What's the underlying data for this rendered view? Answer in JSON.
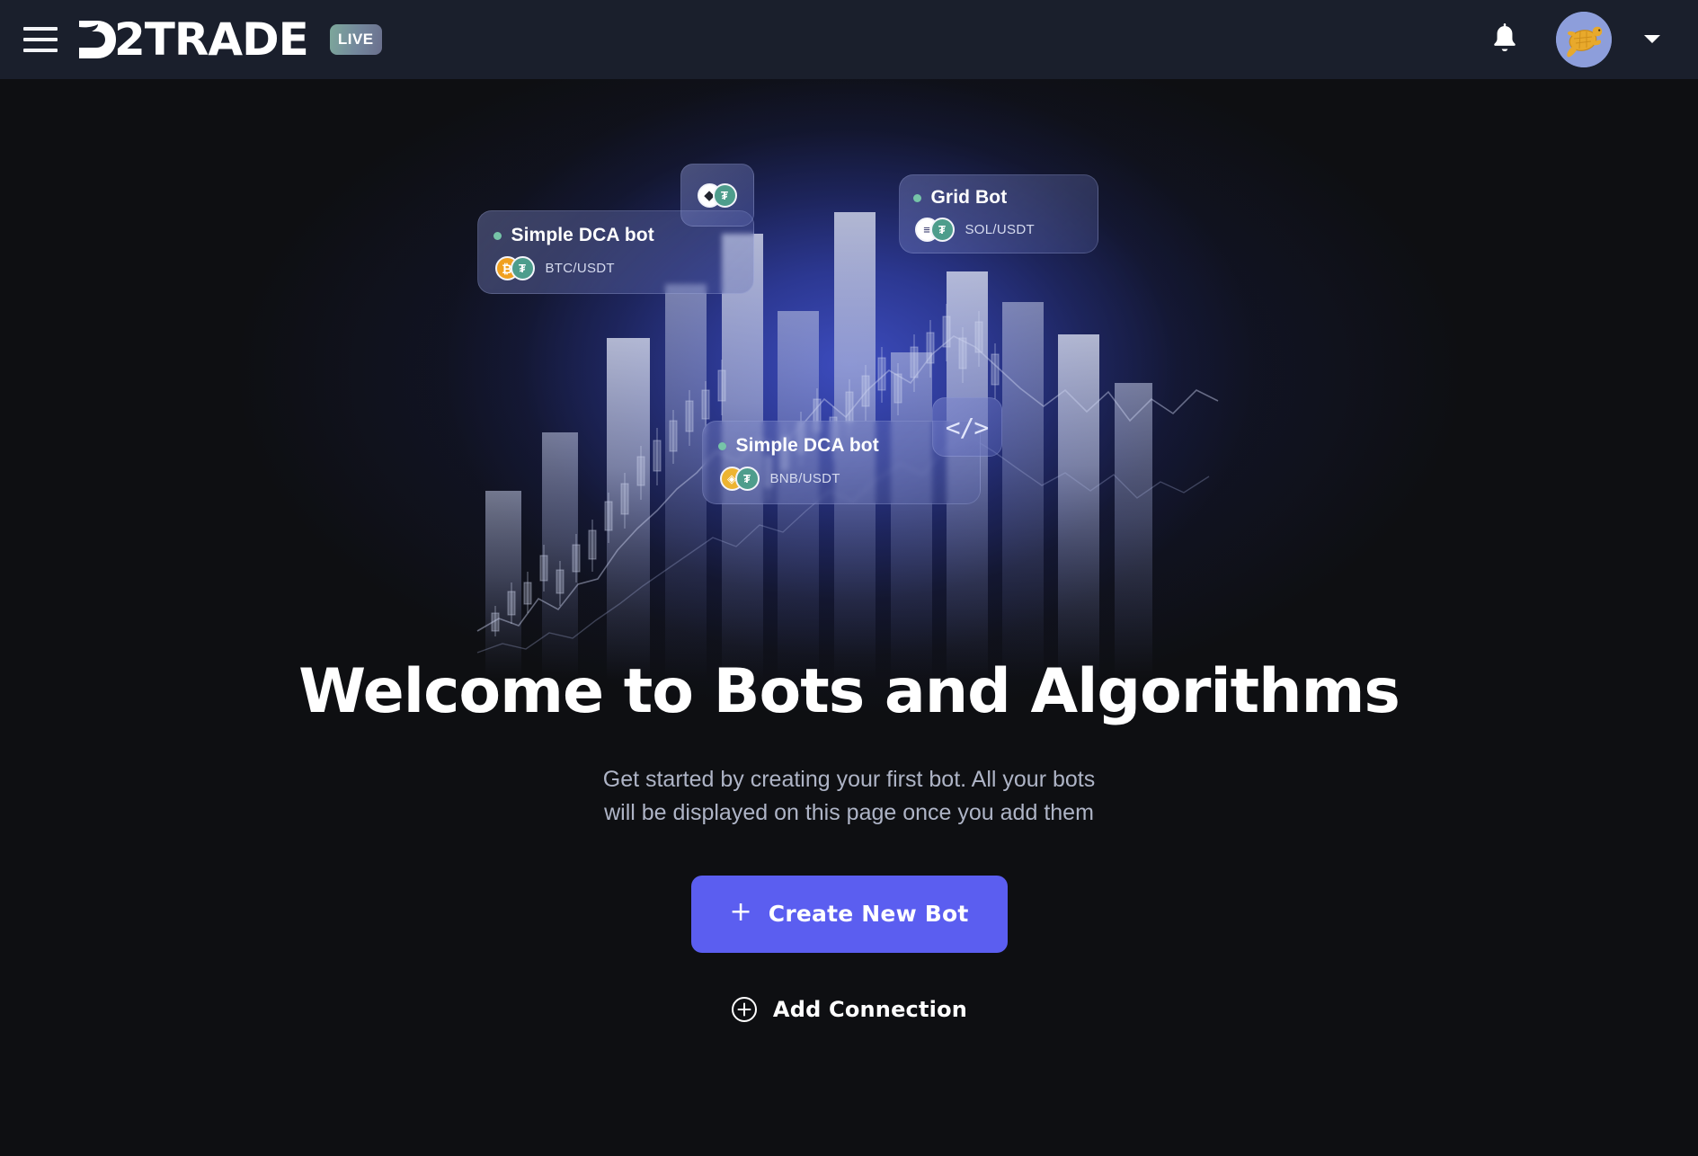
{
  "header": {
    "menu_icon": "hamburger-menu-icon",
    "logo_text": "2TRADE",
    "logo_mark": "stylized-d-logo-icon",
    "live_badge": "LIVE",
    "notifications_icon": "bell-icon",
    "avatar_icon": "turtle-avatar",
    "account_chevron_icon": "chevron-down-icon",
    "colors": {
      "bar_bg": "#1a1f2c",
      "live_gradient_start": "#7da89b",
      "live_gradient_end": "#6a6f8d",
      "avatar_bg": "#8d9edb"
    }
  },
  "hero": {
    "illustration_name": "trading-bots-illustration",
    "glow_color": "#3e4ec4",
    "bot_cards": [
      {
        "name": "Simple DCA bot",
        "pair": "BTC/USDT",
        "status_dot_color": "#76c4a8",
        "coins": [
          "BTC",
          "USDT"
        ],
        "coin_glyphs": [
          "₿",
          "₮"
        ]
      },
      {
        "name": "Simple DCA bot",
        "pair": "BNB/USDT",
        "status_dot_color": "#76c4a8",
        "coins": [
          "BNB",
          "USDT"
        ],
        "coin_glyphs": [
          "◈",
          "₮"
        ]
      },
      {
        "name": "Grid Bot",
        "pair": "SOL/USDT",
        "status_dot_color": "#76c4a8",
        "coins": [
          "SOL",
          "USDT"
        ],
        "coin_glyphs": [
          "≡",
          "₮"
        ]
      }
    ],
    "mini_badges": [
      {
        "name": "eth-usdt-coin-badge",
        "coin_glyphs": [
          "◆",
          "₮"
        ]
      },
      {
        "name": "code-badge",
        "glyph": "</>"
      }
    ]
  },
  "main": {
    "title": "Welcome to Bots and Algorithms",
    "subtitle_line1": "Get started by creating your first bot. All your bots",
    "subtitle_line2": "will be displayed on this page once you add them",
    "create_button": {
      "label": "Create New Bot",
      "icon": "plus-icon",
      "glyph": "+",
      "color": "#5b5ef0"
    },
    "add_connection": {
      "label": "Add Connection",
      "icon": "circle-plus-icon"
    }
  }
}
